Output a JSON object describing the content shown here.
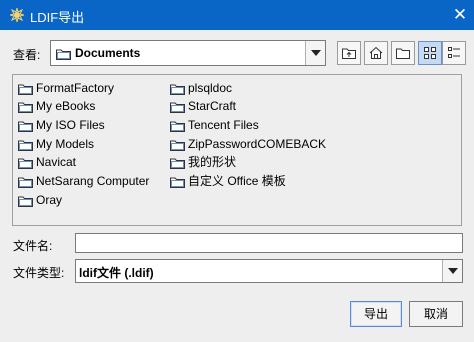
{
  "window": {
    "title": "LDIF导出",
    "close_glyph": "✕"
  },
  "look_in": {
    "label": "查看:",
    "value": "Documents"
  },
  "toolbar": {
    "icons": [
      "up-folder-icon",
      "home-icon",
      "new-folder-icon",
      "list-view-icon",
      "details-view-icon"
    ],
    "selected": "list-view-icon"
  },
  "files": {
    "column1": [
      "FormatFactory",
      "My eBooks",
      "My ISO Files",
      "My Models",
      "Navicat",
      "NetSarang Computer",
      "Oray"
    ],
    "column2": [
      "plsqldoc",
      "StarCraft",
      "Tencent Files",
      "ZipPasswordCOMEBACK",
      "我的形状",
      "自定义 Office 模板"
    ]
  },
  "file_name": {
    "label": "文件名:",
    "value": ""
  },
  "file_type": {
    "label": "文件类型:",
    "value": "ldif文件 (.ldif)"
  },
  "buttons": {
    "save": "导出",
    "cancel": "取消"
  },
  "colors": {
    "titlebar": "#0a66c6",
    "background": "#eeeeee",
    "selected_button": "#c4d9f2"
  }
}
